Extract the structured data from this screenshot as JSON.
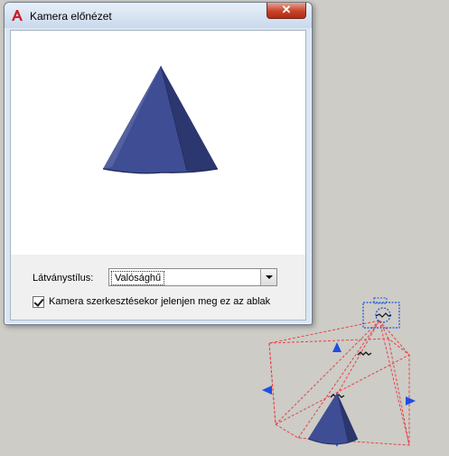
{
  "dialog": {
    "title": "Kamera előnézet",
    "close_glyph": "✕",
    "visual_style_label": "Látványstílus:",
    "visual_style_value": "Valósághű",
    "checkbox_label": "Kamera szerkesztésekor jelenjen meg ez az ablak",
    "checkbox_checked": true
  },
  "icons": {
    "app": "autocad-logo-icon",
    "close": "close-icon",
    "dropdown": "chevron-down-icon"
  },
  "colors": {
    "cone_fill": "#3f4d95",
    "cone_dark": "#25305f",
    "gizmo_blue": "#1d4fe0",
    "frustum_red": "#e8424a"
  }
}
